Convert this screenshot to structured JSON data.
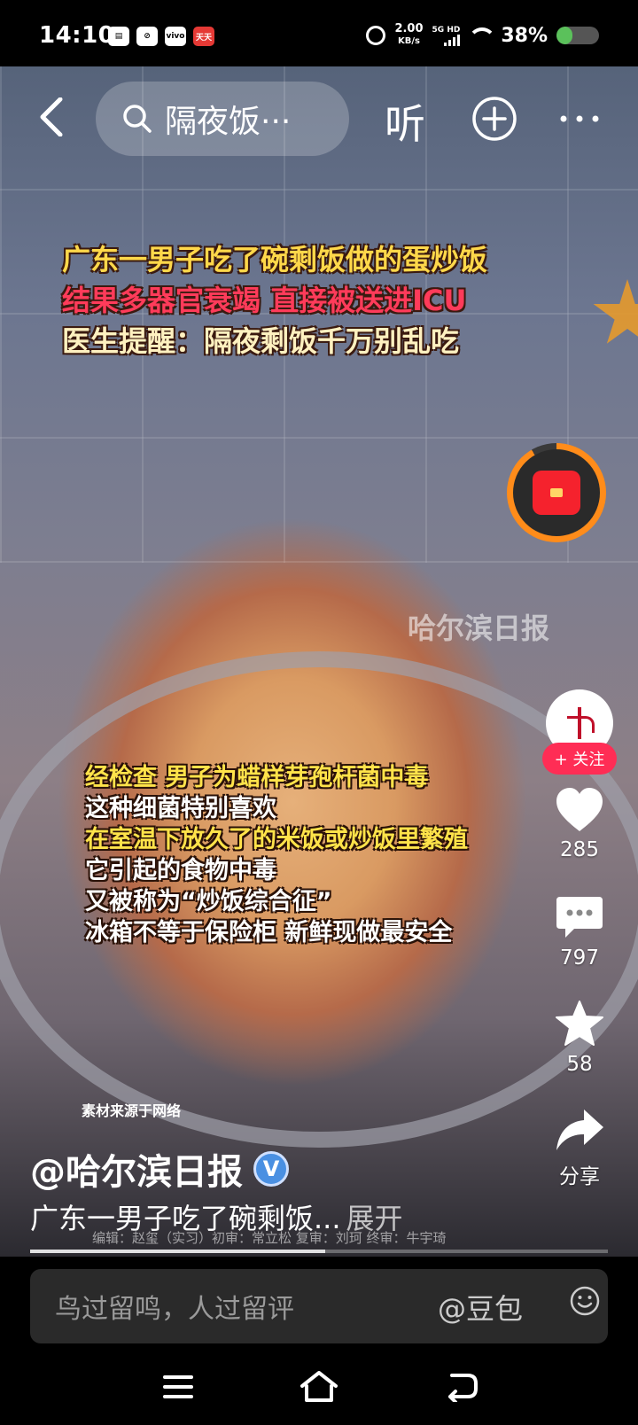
{
  "status_bar": {
    "time": "14:10",
    "left_icons": [
      "sim-icon",
      "app-icon",
      "vivo",
      "天天"
    ],
    "net_speed_value": "2.00",
    "net_speed_unit": "KB/s",
    "signal_label": "5G HD",
    "battery_percent": "38%",
    "battery_level": 0.38
  },
  "top_bar": {
    "search_text": "隔夜饭···",
    "listen_label": "听"
  },
  "video": {
    "headline": [
      "广东一男子吃了碗剩饭做的蛋炒饭",
      "结果多器官衰竭  直接被送进ICU",
      "医生提醒：隔夜剩饭千万别乱吃"
    ],
    "watermark": "哈尔滨日报",
    "subtitles": [
      "经检查  男子为蜡样芽孢杆菌中毒",
      "这种细菌特别喜欢",
      "在室温下放久了的米饭或炒饭里繁殖",
      "它引起的食物中毒",
      "又被称为“炒饭综合征”",
      "冰箱不等于保险柜  新鲜现做最安全"
    ],
    "source_note": "素材来源于网络",
    "credits": "编辑：赵玺（实习）初审：常立松   复审：刘珂   终审：牛宇琦"
  },
  "right_rail": {
    "follow_label": "+ 关注",
    "likes": "285",
    "comments": "797",
    "favorites": "58",
    "share_label": "分享"
  },
  "post": {
    "author": "@哈尔滨日报",
    "verified_mark": "V",
    "caption": "广东一男子吃了碗剩饭...",
    "expand_label": "展开",
    "progress": 0.51
  },
  "comment_bar": {
    "placeholder": "鸟过留鸣，人过留评",
    "doubao_label": "@豆包"
  },
  "colors": {
    "accent_red": "#ff2d55",
    "redpacket_ring": "#ff8c1a",
    "verified_blue": "#4a90e2"
  }
}
